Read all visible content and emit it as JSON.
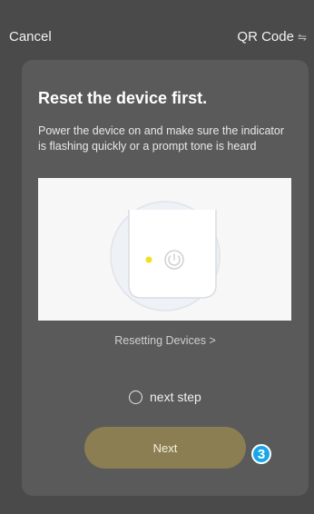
{
  "header": {
    "cancel_label": "Cancel",
    "qr_label": "QR Code",
    "swap_icon": "swap-icon"
  },
  "card": {
    "title": "Reset the device first.",
    "description": "Power the device on and make sure the indicator is flashing quickly or a prompt tone is heard",
    "link_label": "Resetting Devices >",
    "radio_label": "next step",
    "badge_number": "3",
    "next_label": "Next"
  },
  "colors": {
    "background": "#4a4a4a",
    "card": "#5a5a5a",
    "button": "#8a7e52",
    "badge": "#1aa6e6",
    "indicator": "#f2e01c"
  }
}
